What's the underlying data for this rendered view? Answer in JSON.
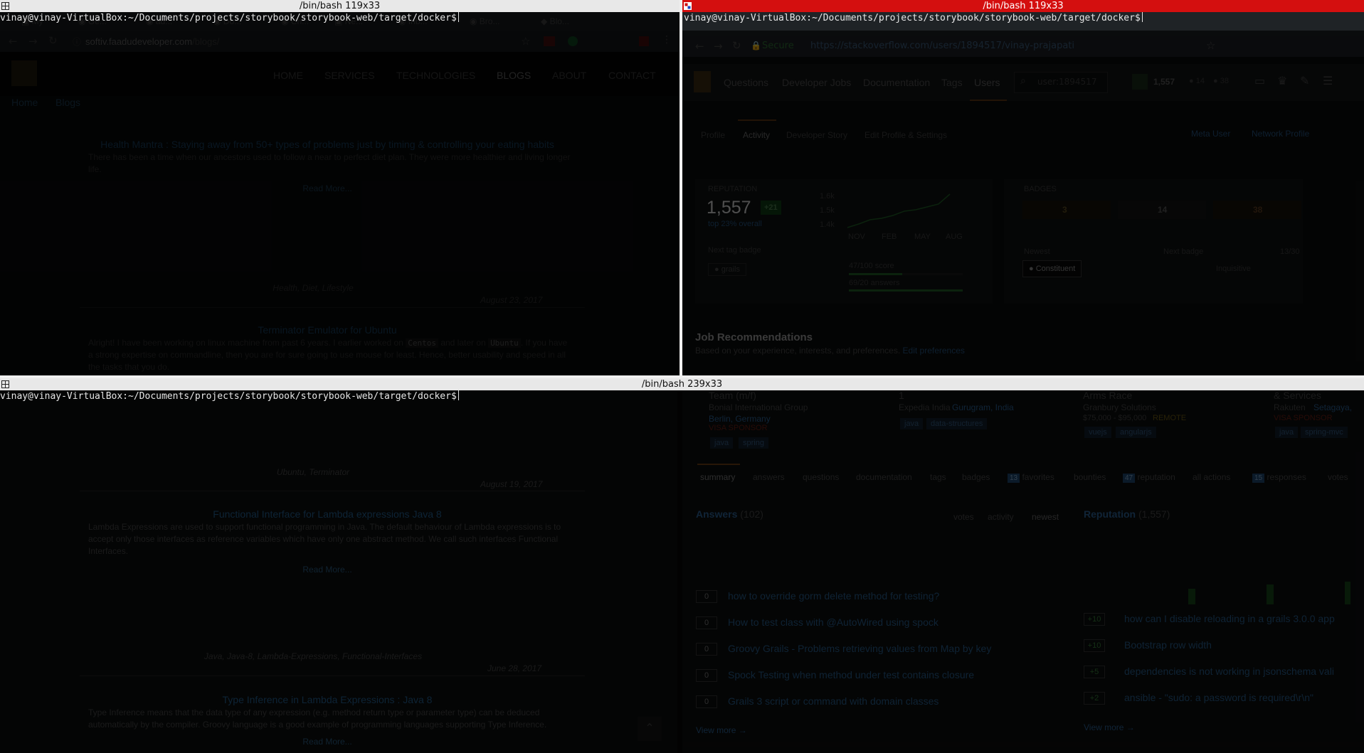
{
  "panes": {
    "top_left_title": "/bin/bash 119x33",
    "top_right_title": "/bin/bash 119x33",
    "bottom_title": "/bin/bash 239x33",
    "prompt": "vinay@vinay-VirtualBox:~/Documents/projects/storybook/storybook-web/target/docker$"
  },
  "left_browser": {
    "url_host": "softiv.faadudeveloper.com",
    "url_path": "/blogs/",
    "nav": [
      "HOME",
      "SERVICES",
      "TECHNOLOGIES",
      "BLOGS",
      "ABOUT",
      "CONTACT"
    ],
    "breadcrumb": [
      "Home",
      "Blogs"
    ],
    "posts": [
      {
        "title": "Health Mantra : Staying away from 50+ types of problems just by timing & controlling your eating habits",
        "text": "There has been a time when our ancestors used to follow a near to perfect diet plan. They were more healthier and living longer life.",
        "read_more": "Read More...",
        "tags": "Health, Diet, Lifestyle",
        "date": "August 23, 2017"
      },
      {
        "title": "Terminator Emulator for Ubuntu",
        "text_a": "Alright! I have been working on linux machine from past 6 years. I earlier worked on",
        "code_a": "Centos",
        "text_b": "and later on",
        "code_b": "Ubuntu",
        "text_c": ". If you have a strong expertise on commandline, then you are for sure going to use mouse for least. Hence, better usability and speed in all the tasks that you do.",
        "tags": "Ubuntu, Terminator",
        "date": "August 19, 2017"
      },
      {
        "title": "Functional Interface for Lambda expressions Java 8",
        "text": "Lambda Expressions are used to support functional programming in Java. The default behaviour of Lambda expressions is to accept only those interfaces as reference variables which have only one abstract method. We call such interfaces Functional Interfaces.",
        "read_more": "Read More...",
        "tags": "Java, Java-8, Lambda-Expressions, Functional-Interfaces",
        "date": "June 28, 2017"
      },
      {
        "title": "Type Inference in Lambda Expressions : Java 8",
        "text": "Type Inference means that the data type of any expression (e.g. method return type or parameter type) can be deduced automatically by the compiler. Groovy language is a good example of programming languages supporting Type Inference.",
        "read_more": "Read More..."
      }
    ]
  },
  "right_browser": {
    "secure": "Secure",
    "url": "https://stackoverflow.com/users/1894517/vinay-prajapati",
    "nav": [
      "Questions",
      "Developer Jobs",
      "Documentation",
      "Tags",
      "Users"
    ],
    "search_placeholder": "user:1894517",
    "rep_header": "1,557",
    "badge_counts": [
      "14",
      "38"
    ],
    "profile_tabs": [
      "Profile",
      "Activity",
      "Developer Story",
      "Edit Profile & Settings"
    ],
    "meta_user": "Meta User",
    "network_profile": "Network Profile",
    "reputation_label": "REPUTATION",
    "reputation_value": "1,557",
    "reputation_delta": "+21",
    "top_percent": "top 23% overall",
    "chart_ticks": [
      "1.6k",
      "1.5k",
      "1.4k"
    ],
    "chart_months": [
      "NOV",
      "FEB",
      "MAY",
      "AUG"
    ],
    "next_tag_badge": "Next tag badge",
    "tag": "grails",
    "score_progress": "47/100 score",
    "answers_progress": "69/20 answers",
    "badges_label": "BADGES",
    "badges": [
      "3",
      "14",
      "38"
    ],
    "newest": "Newest",
    "newest_badge": "Constituent",
    "next_badge": "Next badge",
    "next_badge_name": "Inquisitive",
    "next_badge_progress": "13/30",
    "job_recs_title": "Job Recommendations",
    "job_recs_sub": "Based on your experience, interests, and preferences.",
    "job_recs_edit": "Edit preferences",
    "jobs": [
      {
        "title": "Team (m/f)",
        "company": "Bonial International Group",
        "loc": "Berlin, Germany",
        "flag": "VISA SPONSOR",
        "tags": [
          "java",
          "spring"
        ]
      },
      {
        "title": "1",
        "company": "Expedia India",
        "loc": "Gurugram, India",
        "flag": "",
        "tags": [
          "java",
          "data-structures"
        ]
      },
      {
        "title": "Arms Race",
        "company": "Granbury Solutions",
        "loc": "$75,000 - $95,000",
        "flag": "REMOTE",
        "tags": [
          "vuejs",
          "angularjs"
        ]
      },
      {
        "title": "& Services",
        "company": "Rakuten",
        "loc": "Setagaya,",
        "flag": "VISA SPONSOR",
        "tags": [
          "java",
          "spring-mvc"
        ]
      }
    ],
    "activity_tabs": [
      "summary",
      "answers",
      "questions",
      "documentation",
      "tags",
      "badges",
      "favorites",
      "bounties",
      "reputation",
      "all actions",
      "responses",
      "votes"
    ],
    "tab_counts": {
      "favorites": "13",
      "reputation": "47",
      "responses": "15"
    },
    "answers_title": "Answers",
    "answers_count": "(102)",
    "answer_sorts": [
      "votes",
      "activity",
      "newest"
    ],
    "answers": [
      {
        "score": "0",
        "title": "how to override gorm delete method for testing?"
      },
      {
        "score": "0",
        "title": "How to test class with @AutoWired using spock"
      },
      {
        "score": "0",
        "title": "Groovy Grails - Problems retrieving values from Map by key"
      },
      {
        "score": "0",
        "title": "Spock Testing when method under test contains closure"
      },
      {
        "score": "0",
        "title": "Grails 3 script or command with domain classes"
      }
    ],
    "view_more": "View more →",
    "rep_title": "Reputation",
    "rep_count": "(1,557)",
    "rep_items": [
      {
        "delta": "+10",
        "title": "how can I disable reloading in a grails 3.0.0 app"
      },
      {
        "delta": "+10",
        "title": "Bootstrap row width"
      },
      {
        "delta": "+5",
        "title": "dependencies is not working in jsonschema vali"
      },
      {
        "delta": "+2",
        "title": "ansible - \"sudo: a password is required\\r\\n\""
      }
    ],
    "rep_view_more": "View more →"
  }
}
